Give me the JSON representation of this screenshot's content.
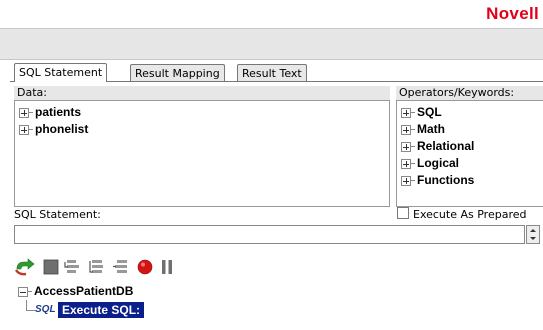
{
  "brand": "Novell",
  "tabs": [
    "SQL Statement",
    "Result Mapping",
    "Result Text"
  ],
  "data_panel": {
    "label": "Data:",
    "items": [
      "patients",
      "phonelist"
    ]
  },
  "operators_panel": {
    "label": "Operators/Keywords:",
    "items": [
      "SQL",
      "Math",
      "Relational",
      "Logical",
      "Functions"
    ]
  },
  "sql_statement": {
    "label": "SQL Statement:",
    "value": "",
    "execute_as_prepared_label": "Execute As Prepared",
    "execute_as_prepared_checked": false
  },
  "toolbar": {
    "icons": [
      "refresh-icon",
      "stop-icon",
      "step-into-icon",
      "step-over-icon",
      "step-out-icon",
      "record-icon",
      "pause-icon"
    ]
  },
  "tree": {
    "root": "AccessPatientDB",
    "step_prefix": "SQL",
    "step_label": "Execute SQL:"
  },
  "colors": {
    "brand_red": "#e2001a",
    "selection_blue": "#0a1f8c"
  }
}
